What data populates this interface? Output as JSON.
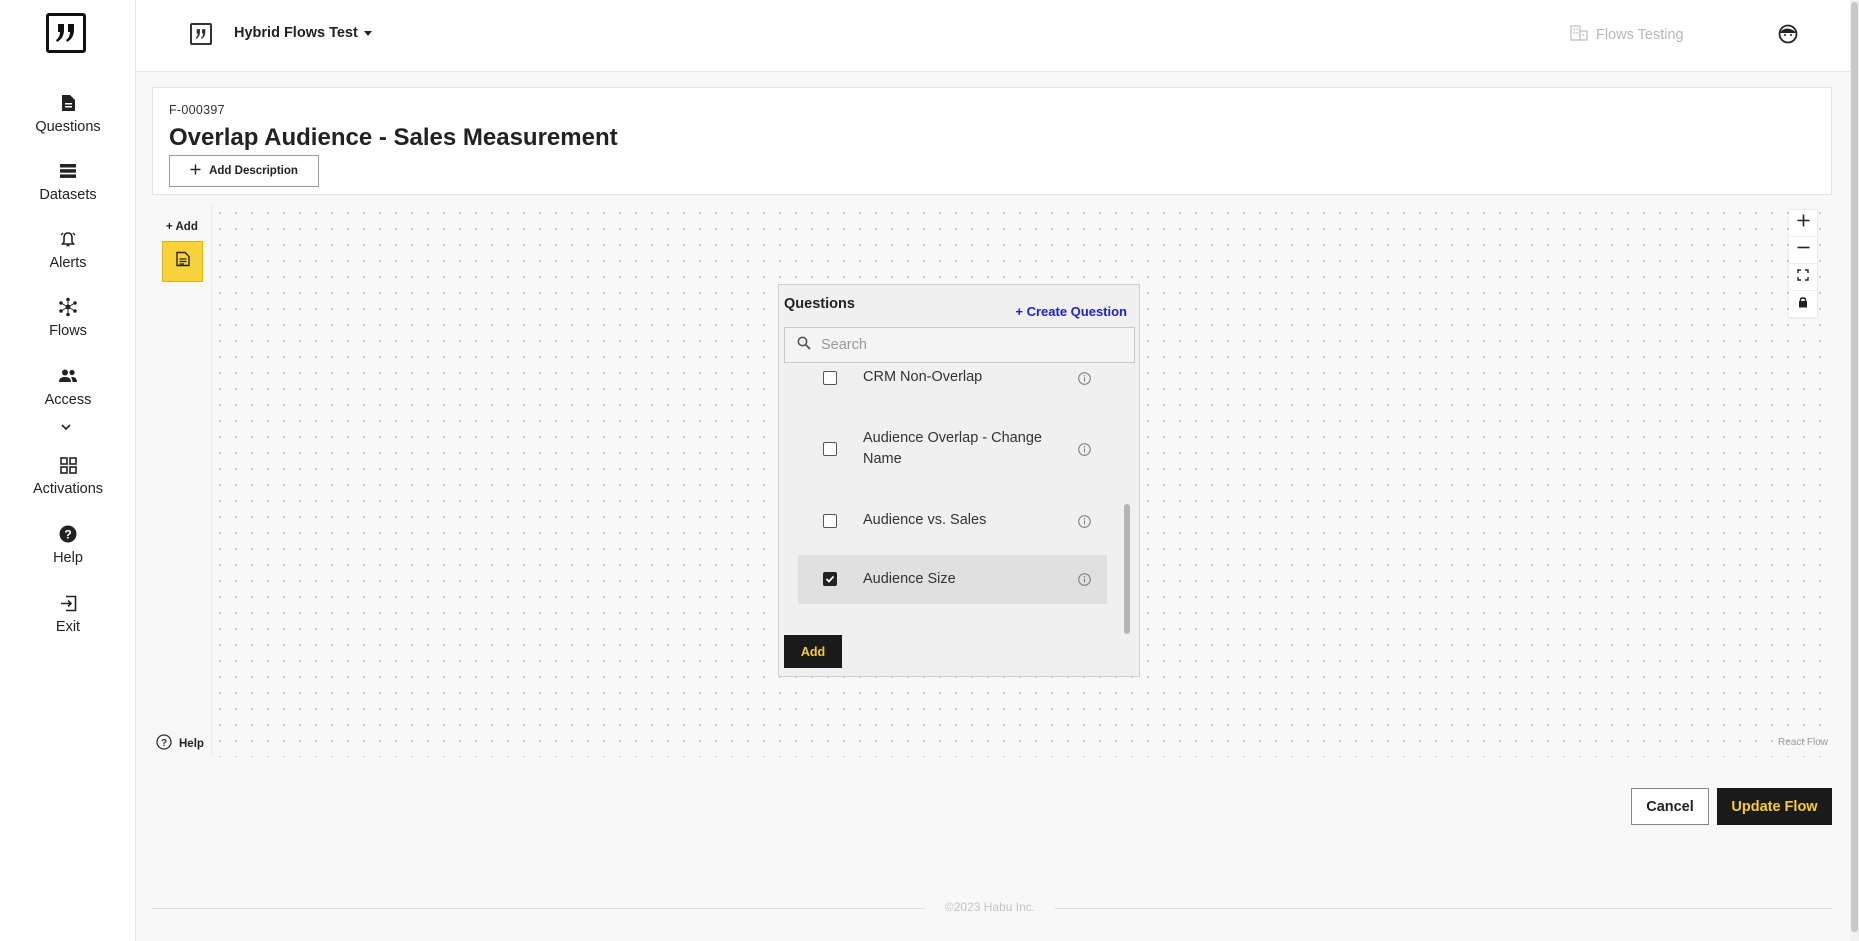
{
  "sidebar": {
    "items": [
      {
        "label": "Questions",
        "icon": "document-icon"
      },
      {
        "label": "Datasets",
        "icon": "database-icon"
      },
      {
        "label": "Alerts",
        "icon": "bell-icon"
      },
      {
        "label": "Flows",
        "icon": "network-icon"
      },
      {
        "label": "Access",
        "icon": "people-icon"
      },
      {
        "label": "Activations",
        "icon": "grid-icon"
      },
      {
        "label": "Help",
        "icon": "help-icon"
      },
      {
        "label": "Exit",
        "icon": "exit-icon"
      }
    ]
  },
  "header": {
    "org_name": "Hybrid Flows Test",
    "workspace": "Flows Testing"
  },
  "flow": {
    "id": "F-000397",
    "title": "Overlap Audience - Sales Measurement",
    "add_description_label": "Add Description"
  },
  "canvas": {
    "add_label": "+ Add",
    "help_label": "Help",
    "attribution": "React Flow"
  },
  "questions_panel": {
    "title": "Questions",
    "create_label": "+ Create Question",
    "search_placeholder": "Search",
    "items": [
      {
        "label": "CRM Non-Overlap",
        "checked": false
      },
      {
        "label": "Audience Overlap - Change Name",
        "checked": false
      },
      {
        "label": "Audience vs. Sales",
        "checked": false
      },
      {
        "label": "Audience Size",
        "checked": true
      }
    ],
    "add_label": "Add"
  },
  "actions": {
    "cancel_label": "Cancel",
    "update_label": "Update Flow"
  },
  "footer": {
    "copyright": "©2023 Habu Inc."
  },
  "colors": {
    "accent_yellow": "#f8d43a",
    "button_dark": "#1a1a1a",
    "link_blue": "#1e22c8"
  }
}
